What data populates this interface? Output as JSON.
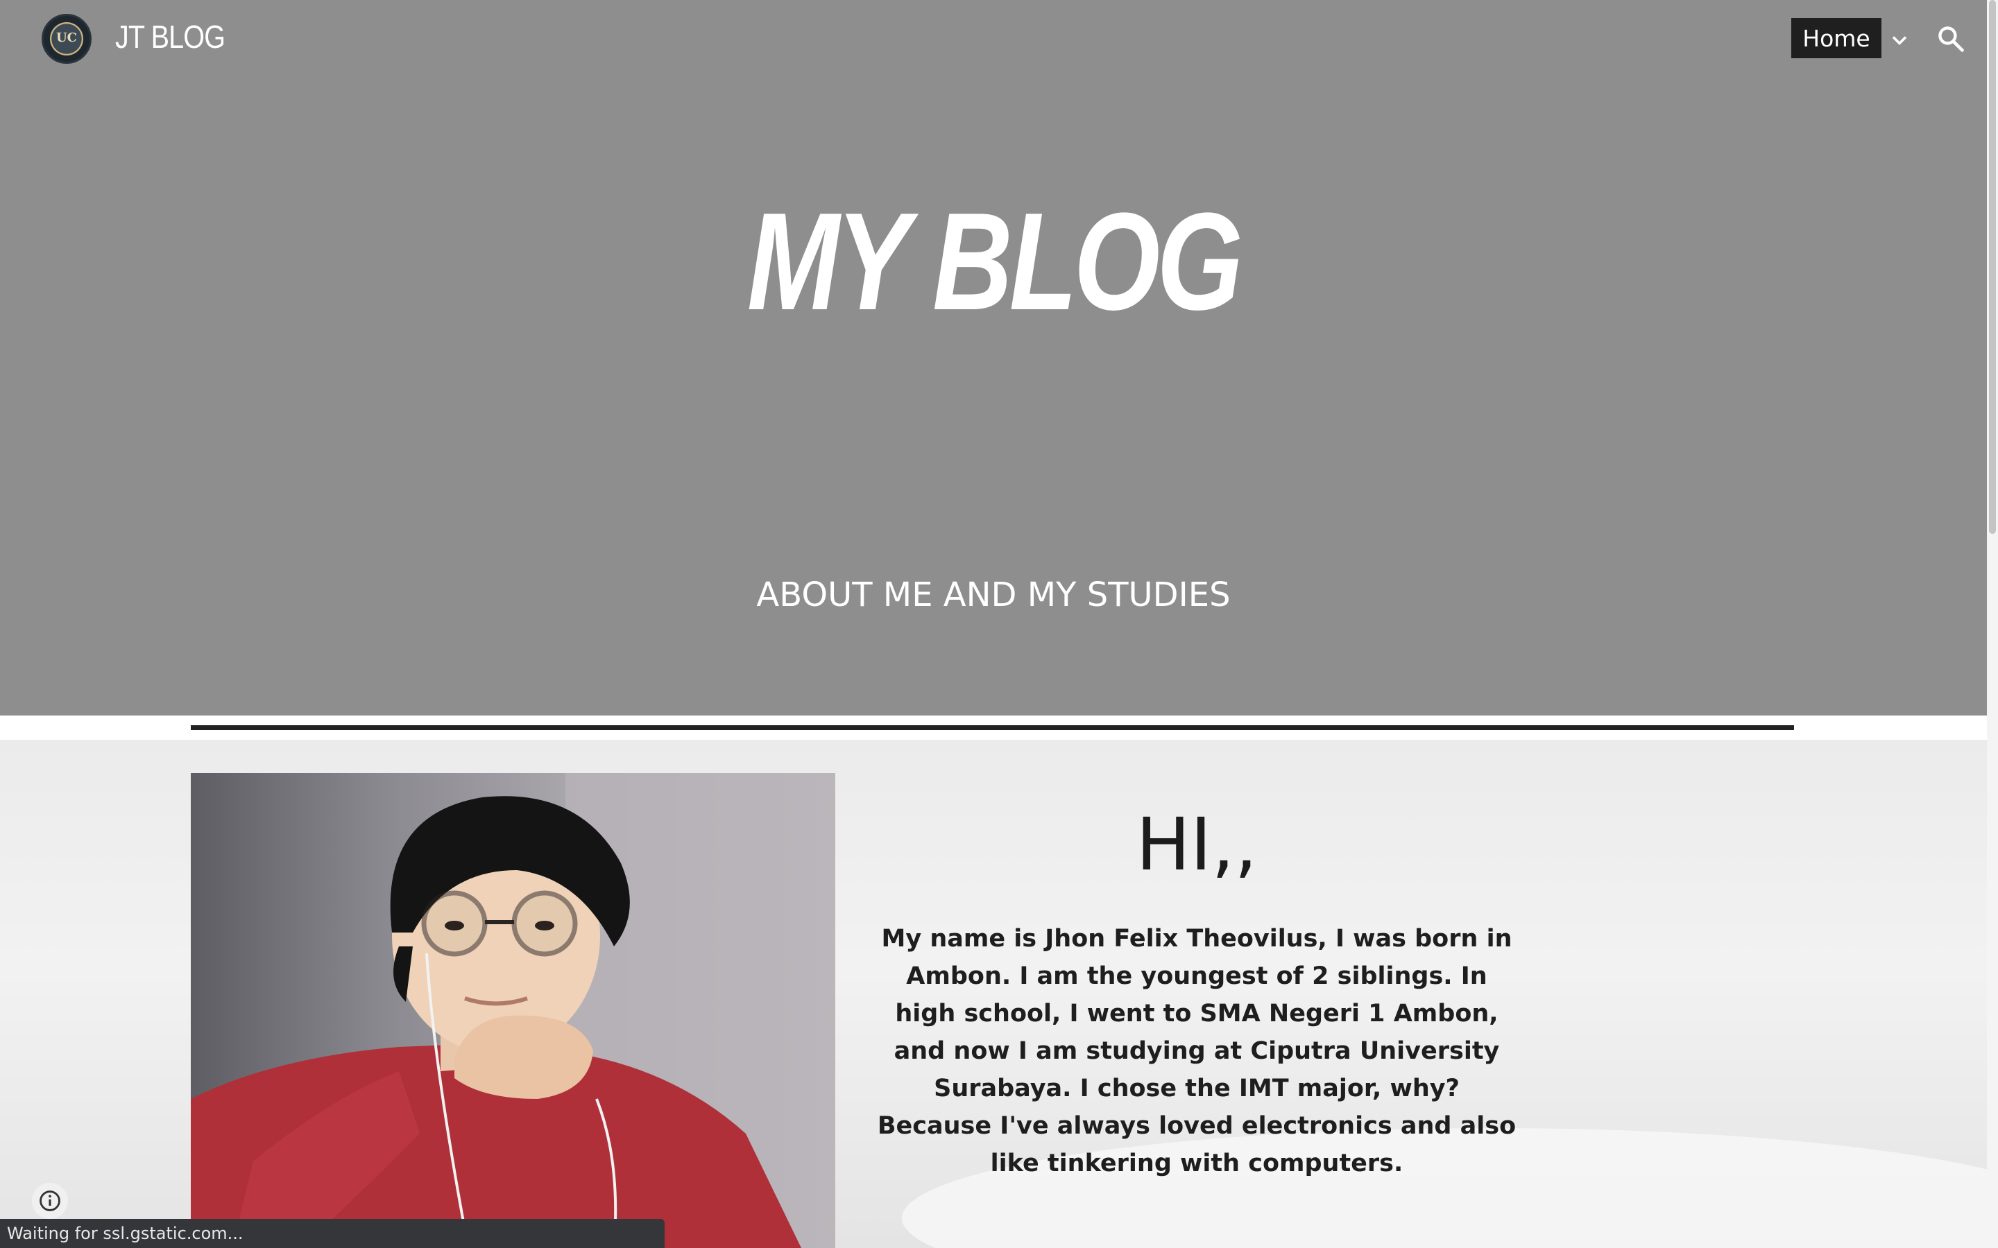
{
  "header": {
    "site_title": "JT BLOG",
    "logo_text": "UC",
    "nav": {
      "home_label": "Home"
    }
  },
  "hero": {
    "title": "MY BLOG",
    "subtitle": "ABOUT ME AND MY STUDIES"
  },
  "about": {
    "greeting": "HI,,",
    "bio": "My name is Jhon Felix Theovilus, I was born in Ambon. I am the youngest of 2 siblings. In high school, I went to SMA Negeri 1 Ambon, and now I am studying at Ciputra University Surabaya. I chose the IMT major, why? Because I've always loved electronics and also like tinkering with computers."
  },
  "status_bar": {
    "text": "Waiting for ssl.gstatic.com..."
  },
  "icons": {
    "logo": "university-logo-icon",
    "chevron": "chevron-down-icon",
    "search": "search-icon",
    "info": "info-icon"
  },
  "colors": {
    "hero_bg": "#8e8e8e",
    "nav_active_bg": "#1f1f1f",
    "divider": "#222222",
    "status_bar_bg": "#34363a"
  }
}
